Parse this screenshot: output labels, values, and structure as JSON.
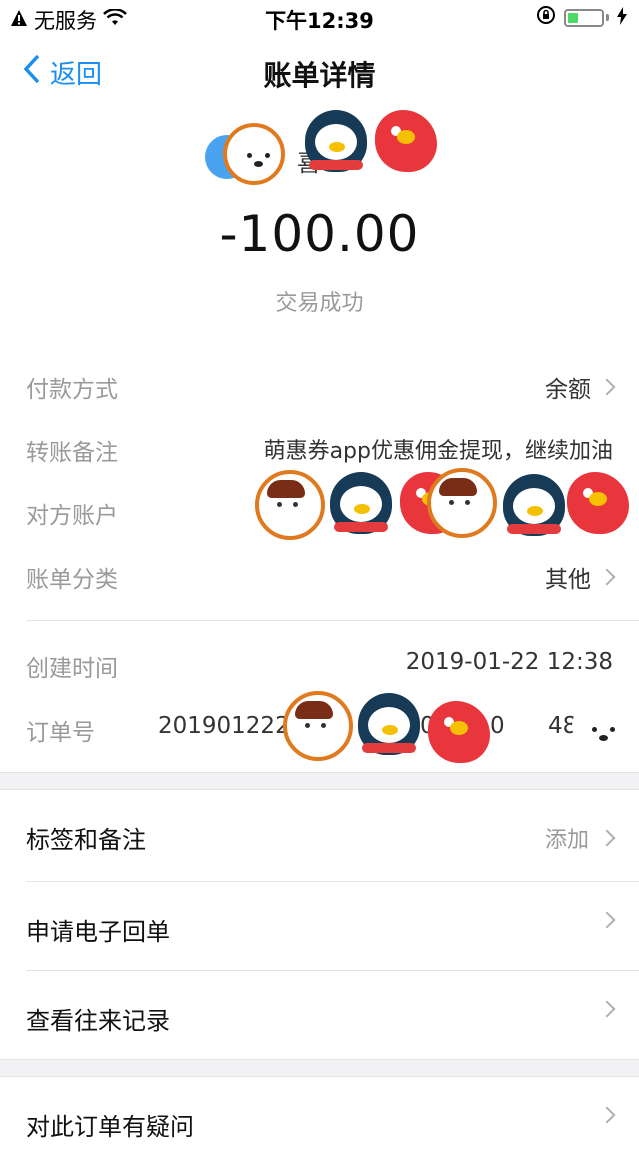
{
  "status_bar": {
    "carrier": "无服务",
    "time": "下午12:39"
  },
  "nav": {
    "back_label": "返回",
    "title": "账单详情"
  },
  "header": {
    "counterparty_partial": "喜",
    "amount": "-100.00",
    "status": "交易成功"
  },
  "details": {
    "payment_method": {
      "label": "付款方式",
      "value": "余额"
    },
    "transfer_note": {
      "label": "转账备注",
      "value": "萌惠券app优惠佣金提现，继续加油"
    },
    "counterparty_account": {
      "label": "对方账户",
      "value": ""
    },
    "category": {
      "label": "账单分类",
      "value": "其他"
    },
    "created_time": {
      "label": "创建时间",
      "value": "2019-01-22 12:38"
    },
    "order_no": {
      "label": "订单号",
      "value_prefix": "201901222",
      "value_fragment_1": "0",
      "value_fragment_2": "0",
      "value_suffix": "48"
    }
  },
  "actions": {
    "tags_notes": {
      "label": "标签和备注",
      "right_text": "添加"
    },
    "e_receipt": {
      "label": "申请电子回单"
    },
    "history": {
      "label": "查看往来记录"
    },
    "dispute": {
      "label": "对此订单有疑问"
    }
  },
  "colors": {
    "accent": "#1a8ff0",
    "muted": "#9a9a9a",
    "band": "#f2f2f4",
    "battery": "#4cd964"
  },
  "icons": [
    "warning-icon",
    "wifi-icon",
    "orientation-lock-icon",
    "battery-icon",
    "charging-icon",
    "back-chevron-icon",
    "chevron-right-icon"
  ]
}
